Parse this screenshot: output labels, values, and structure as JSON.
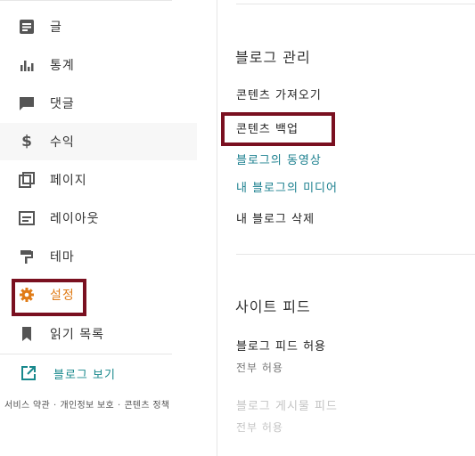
{
  "sidebar": {
    "items": [
      {
        "label": "글",
        "icon": "posts-icon"
      },
      {
        "label": "통계",
        "icon": "stats-icon"
      },
      {
        "label": "댓글",
        "icon": "comments-icon"
      },
      {
        "label": "수익",
        "icon": "dollar-icon"
      },
      {
        "label": "페이지",
        "icon": "pages-icon"
      },
      {
        "label": "레이아웃",
        "icon": "layout-icon"
      },
      {
        "label": "테마",
        "icon": "paint-roller-icon"
      },
      {
        "label": "설정",
        "icon": "gear-icon"
      },
      {
        "label": "읽기 목록",
        "icon": "bookmark-icon"
      }
    ],
    "view_blog": "블로그 보기",
    "footer": {
      "terms": "서비스 약관",
      "privacy": "개인정보 보호",
      "content_policy": "콘텐츠 정책",
      "separator": "·"
    }
  },
  "main": {
    "blog_management": {
      "title": "블로그 관리",
      "import": "콘텐츠 가져오기",
      "backup": "콘텐츠 백업",
      "videos": "블로그의 동영상",
      "media": "내 블로그의 미디어",
      "delete": "내 블로그 삭제"
    },
    "site_feed": {
      "title": "사이트 피드",
      "allow_feed_label": "블로그 피드 허용",
      "allow_feed_value": "전부 허용",
      "post_feed_label": "블로그 게시물 피드",
      "post_feed_value": "전부 허용"
    }
  },
  "colors": {
    "accent_orange": "#e07c18",
    "teal": "#1a7f8e",
    "highlight_box": "#7a1020"
  }
}
